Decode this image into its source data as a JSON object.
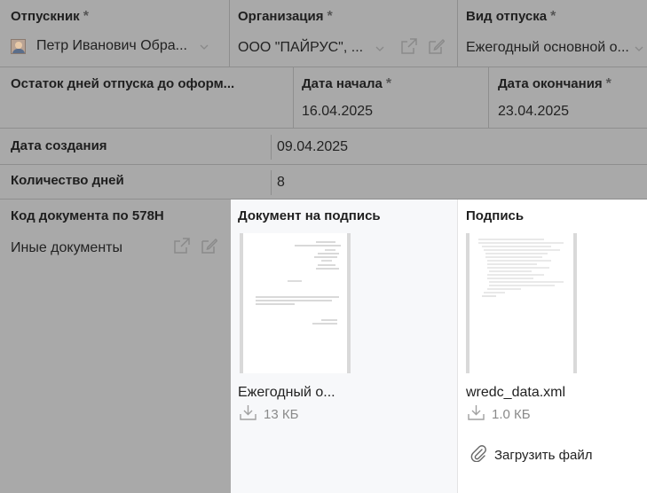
{
  "row1": {
    "employee": {
      "label": "Отпускник",
      "required": "*",
      "value": "Петр Иванович Обра..."
    },
    "organization": {
      "label": "Организация",
      "required": "*",
      "value": "ООО \"ПАЙРУС\", ..."
    },
    "leave_type": {
      "label": "Вид отпуска",
      "required": "*",
      "value": "Ежегодный основной о..."
    }
  },
  "row2": {
    "remaining_days": {
      "label": "Остаток дней отпуска до оформ..."
    },
    "start_date": {
      "label": "Дата начала",
      "required": "*",
      "value": "16.04.2025"
    },
    "end_date": {
      "label": "Дата окончания",
      "required": "*",
      "value": "23.04.2025"
    }
  },
  "created_date": {
    "label": "Дата создания",
    "value": "09.04.2025"
  },
  "days_count": {
    "label": "Количество дней",
    "value": "8"
  },
  "doc_code": {
    "label": "Код документа по 578Н",
    "other_docs": "Иные документы"
  },
  "document_panel": {
    "title": "Документ на подпись",
    "file_name": "Ежегодный о...",
    "file_size": "13 КБ"
  },
  "signature_panel": {
    "title": "Подпись",
    "file_name": "wredc_data.xml",
    "file_size": "1.0 КБ",
    "upload_label": "Загрузить файл"
  },
  "colors": {
    "overlay_gray": "#a9a9a9",
    "panel_left": "#f7f8fa",
    "panel_right": "#ffffff",
    "divider": "#8e8e8e"
  }
}
